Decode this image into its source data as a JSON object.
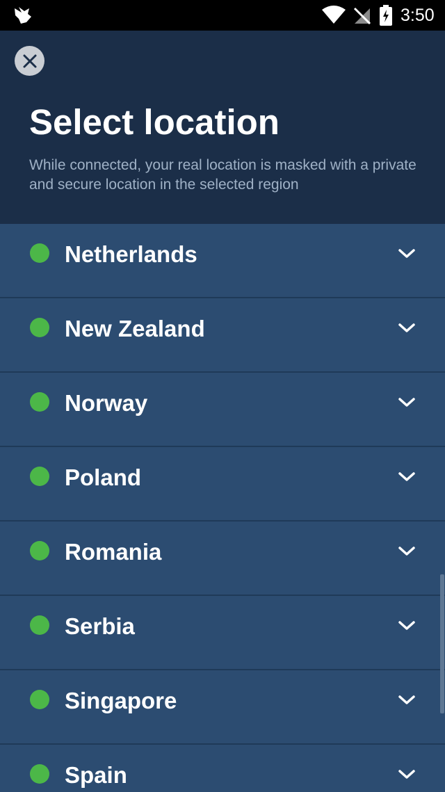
{
  "status_bar": {
    "time": "3:50",
    "icons": [
      "app-notification-icon",
      "wifi-icon",
      "no-signal-icon",
      "battery-charging-icon"
    ]
  },
  "header": {
    "close_icon": "close-icon",
    "title": "Select location",
    "subtitle": "While connected, your real location is masked with a private and secure location in the selected region"
  },
  "locations": [
    {
      "name": "Netherlands",
      "status": "available",
      "status_color": "#4cb748"
    },
    {
      "name": "New Zealand",
      "status": "available",
      "status_color": "#4cb748"
    },
    {
      "name": "Norway",
      "status": "available",
      "status_color": "#4cb748"
    },
    {
      "name": "Poland",
      "status": "available",
      "status_color": "#4cb748"
    },
    {
      "name": "Romania",
      "status": "available",
      "status_color": "#4cb748"
    },
    {
      "name": "Serbia",
      "status": "available",
      "status_color": "#4cb748"
    },
    {
      "name": "Singapore",
      "status": "available",
      "status_color": "#4cb748"
    },
    {
      "name": "Spain",
      "status": "available",
      "status_color": "#4cb748"
    }
  ],
  "colors": {
    "header_bg": "#1b2e48",
    "list_bg": "#2c4c71",
    "accent_green": "#4cb748"
  }
}
